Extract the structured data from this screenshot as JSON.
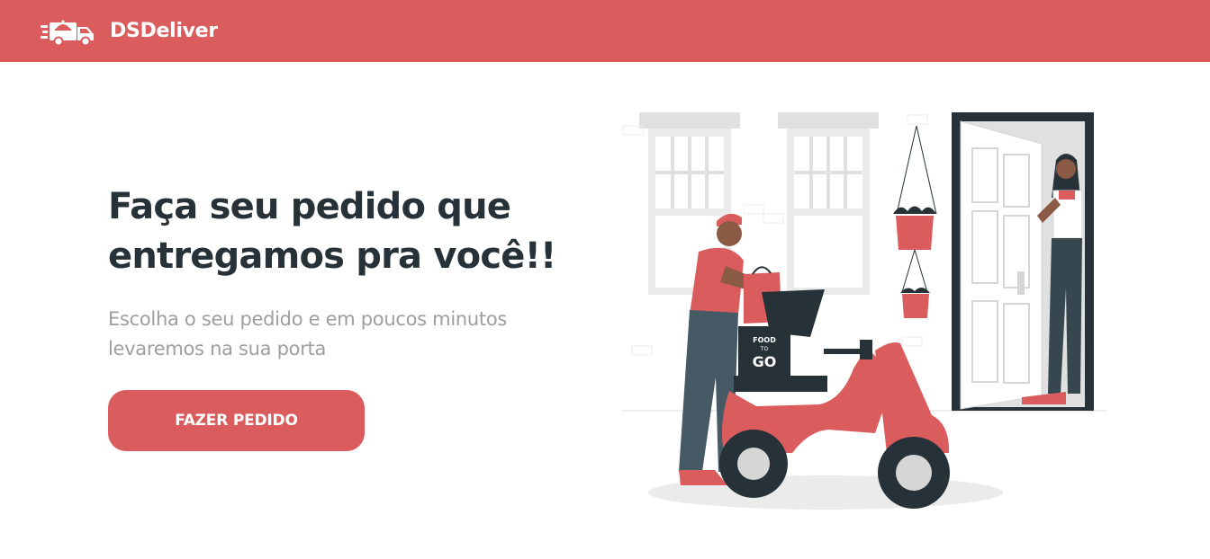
{
  "navbar": {
    "brand_name": "DSDeliver",
    "logo_icon": "delivery-truck-icon",
    "background": "#DA5C5C"
  },
  "hero": {
    "title_line1": "Faça seu pedido que",
    "title_line2": "entregamos pra você!!",
    "subtitle_line1": "Escolha o seu pedido e em poucos minutos",
    "subtitle_line2": "levaremos na sua porta",
    "cta_label": "FAZER PEDIDO"
  },
  "illustration": {
    "box_text_top": "FOOD",
    "box_text_mid": "TO",
    "box_text_bottom": "GO",
    "accent": "#DA5C5C",
    "dark": "#263238"
  }
}
